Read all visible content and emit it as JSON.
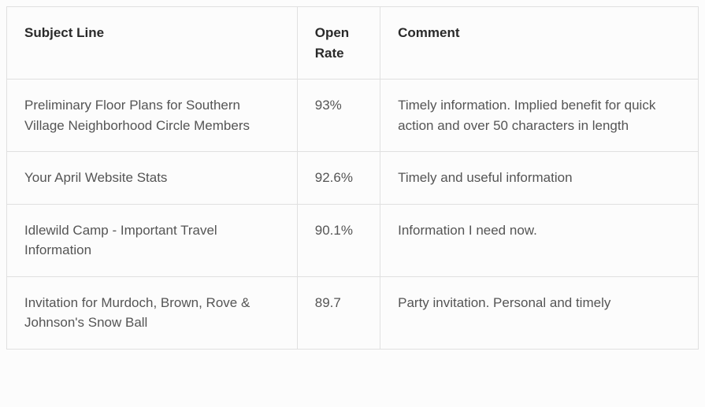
{
  "table": {
    "headers": {
      "subject": "Subject Line",
      "rate": "Open Rate",
      "comment": "Comment"
    },
    "rows": [
      {
        "subject": "Preliminary Floor Plans for Southern Village Neighborhood Circle Members",
        "rate": "93%",
        "comment": "Timely information. Implied benefit for quick action and over 50 characters in length"
      },
      {
        "subject": "Your April Website Stats",
        "rate": "92.6%",
        "comment": "Timely and useful information"
      },
      {
        "subject": "Idlewild Camp - Important Travel Information",
        "rate": "90.1%",
        "comment": "Information I need now."
      },
      {
        "subject": "Invitation for Murdoch, Brown, Rove & Johnson's Snow Ball",
        "rate": "89.7",
        "comment": "Party invitation. Personal and timely"
      }
    ]
  }
}
